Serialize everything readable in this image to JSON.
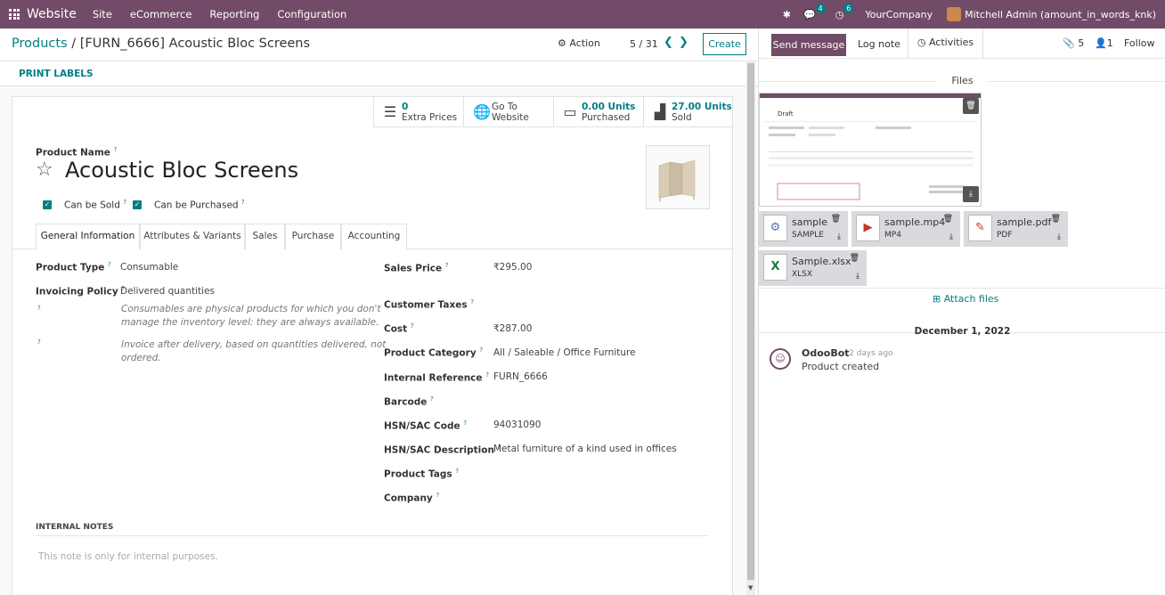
{
  "navbar": {
    "brand": "Website",
    "menu": [
      "Site",
      "eCommerce",
      "Reporting",
      "Configuration"
    ],
    "messages_count": "4",
    "activities_count": "6",
    "company": "YourCompany",
    "user": "Mitchell Admin (amount_in_words_knk)"
  },
  "control_panel": {
    "breadcrumb_parent": "Products",
    "breadcrumb_sep": "/",
    "breadcrumb_current": "[FURN_6666] Acoustic Bloc Screens",
    "action": "Action",
    "pager": "5 / 31",
    "create": "Create",
    "print_labels": "PRINT LABELS"
  },
  "smart_buttons": {
    "extra_prices_value": "0",
    "extra_prices_label": "Extra Prices",
    "go_to_1": "Go To",
    "go_to_2": "Website",
    "purchased_value": "0.00 Units",
    "purchased_label": "Purchased",
    "sold_value": "27.00 Units",
    "sold_label": "Sold"
  },
  "product": {
    "name_label": "Product Name",
    "name": "Acoustic Bloc Screens",
    "can_be_sold": "Can be Sold",
    "can_be_purchased": "Can be Purchased"
  },
  "tabs": [
    "General Information",
    "Attributes & Variants",
    "Sales",
    "Purchase",
    "Accounting"
  ],
  "general": {
    "product_type_label": "Product Type",
    "product_type": "Consumable",
    "invoicing_policy_label": "Invoicing Policy",
    "invoicing_policy": "Delivered quantities",
    "help_type_1": "Consumables are physical products for which you don't",
    "help_type_2": "manage the inventory level: they are always available.",
    "help_invoice_1": "Invoice after delivery, based on quantities delivered, not",
    "help_invoice_2": "ordered.",
    "sales_price_label": "Sales Price",
    "sales_price": "₹295.00",
    "customer_taxes_label": "Customer Taxes",
    "cost_label": "Cost",
    "cost": "₹287.00",
    "category_label": "Product Category",
    "category": "All / Saleable / Office Furniture",
    "internal_ref_label": "Internal Reference",
    "internal_ref": "FURN_6666",
    "barcode_label": "Barcode",
    "hsn_code_label": "HSN/SAC Code",
    "hsn_code": "94031090",
    "hsn_desc_label": "HSN/SAC Description",
    "hsn_desc": "Metal furniture of a kind used in offices",
    "tags_label": "Product Tags",
    "company_label": "Company",
    "help_mark": "?"
  },
  "notes": {
    "header": "INTERNAL NOTES",
    "placeholder": "This note is only for internal purposes."
  },
  "chatter": {
    "send_message": "Send message",
    "log_note": "Log note",
    "activities": "Activities",
    "attachments_count": "5",
    "followers_count": "1",
    "follow": "Follow",
    "files_header": "Files",
    "attachments": [
      {
        "name": "sample",
        "ext": "SAMPLE"
      },
      {
        "name": "sample.mp4",
        "ext": "MP4"
      },
      {
        "name": "sample.pdf",
        "ext": "PDF"
      },
      {
        "name": "Sample.xlsx",
        "ext": "XLSX"
      }
    ],
    "attach_files": "Attach files",
    "date": "December 1, 2022",
    "author": "OdooBot",
    "time": "- 2 days ago",
    "message": "Product created",
    "preview_title": "Draft"
  },
  "colors": {
    "brand": "#714B67",
    "accent": "#017e84"
  }
}
